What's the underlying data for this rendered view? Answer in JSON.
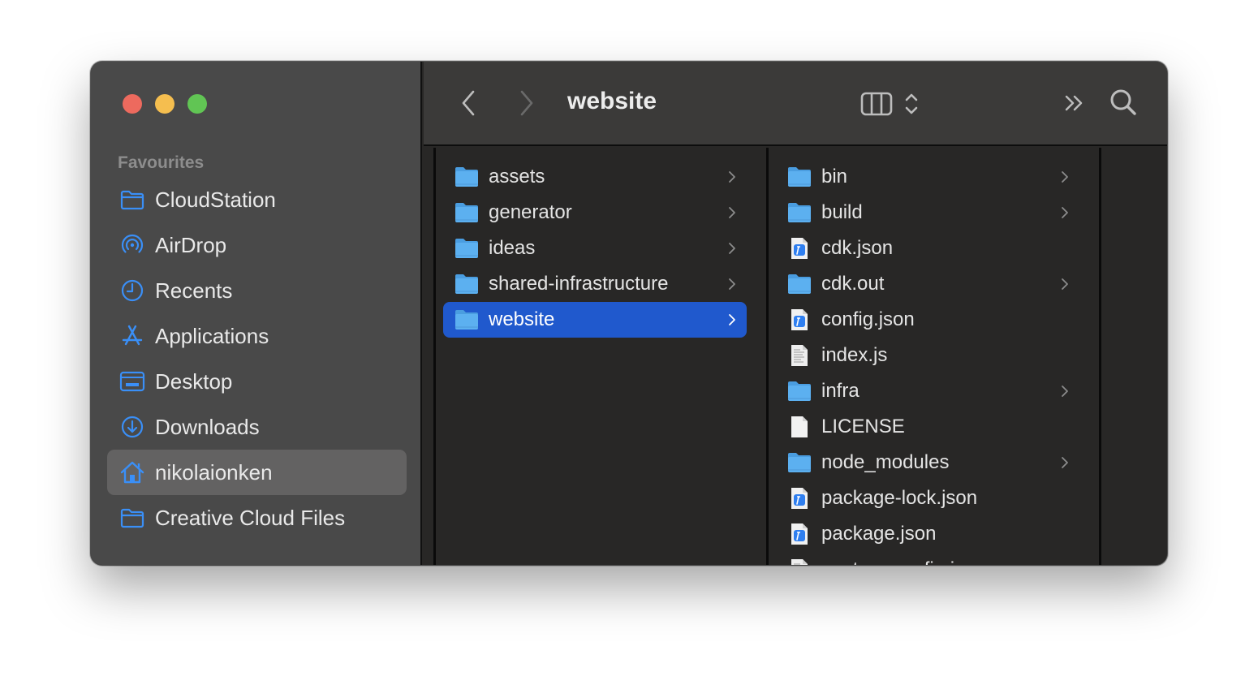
{
  "window": {
    "title": "website",
    "traffic_lights": [
      {
        "name": "close",
        "color": "#ed6a5e"
      },
      {
        "name": "minimize",
        "color": "#f5be4f"
      },
      {
        "name": "zoom",
        "color": "#61c554"
      }
    ]
  },
  "sidebar": {
    "section_label": "Favourites",
    "accent_color": "#3a8ff7",
    "items": [
      {
        "label": "CloudStation",
        "icon": "folder-icon",
        "selected": false
      },
      {
        "label": "AirDrop",
        "icon": "airdrop-icon",
        "selected": false
      },
      {
        "label": "Recents",
        "icon": "clock-icon",
        "selected": false
      },
      {
        "label": "Applications",
        "icon": "applications-icon",
        "selected": false
      },
      {
        "label": "Desktop",
        "icon": "desktop-icon",
        "selected": false
      },
      {
        "label": "Downloads",
        "icon": "download-icon",
        "selected": false
      },
      {
        "label": "nikolaionken",
        "icon": "home-icon",
        "selected": true
      },
      {
        "label": "Creative Cloud Files",
        "icon": "folder-icon",
        "selected": false
      }
    ]
  },
  "toolbar": {
    "back_icon": "chevron-left-icon",
    "forward_icon": "chevron-right-icon",
    "title": "website",
    "view_mode_icon": "column-view-icon",
    "more_icon": "double-chevron-right-icon",
    "search_icon": "search-icon"
  },
  "columns": [
    {
      "items": [
        {
          "name": "assets",
          "type": "folder",
          "has_children": true,
          "selected": false
        },
        {
          "name": "generator",
          "type": "folder",
          "has_children": true,
          "selected": false
        },
        {
          "name": "ideas",
          "type": "folder",
          "has_children": true,
          "selected": false
        },
        {
          "name": "shared-infrastructure",
          "type": "folder",
          "has_children": true,
          "selected": false
        },
        {
          "name": "website",
          "type": "folder",
          "has_children": true,
          "selected": true
        }
      ]
    },
    {
      "items": [
        {
          "name": "bin",
          "type": "folder",
          "has_children": true,
          "selected": false
        },
        {
          "name": "build",
          "type": "folder",
          "has_children": true,
          "selected": false
        },
        {
          "name": "cdk.json",
          "type": "json",
          "has_children": false,
          "selected": false
        },
        {
          "name": "cdk.out",
          "type": "folder",
          "has_children": true,
          "selected": false
        },
        {
          "name": "config.json",
          "type": "json",
          "has_children": false,
          "selected": false
        },
        {
          "name": "index.js",
          "type": "text",
          "has_children": false,
          "selected": false
        },
        {
          "name": "infra",
          "type": "folder",
          "has_children": true,
          "selected": false
        },
        {
          "name": "LICENSE",
          "type": "blank",
          "has_children": false,
          "selected": false
        },
        {
          "name": "node_modules",
          "type": "folder",
          "has_children": true,
          "selected": false
        },
        {
          "name": "package-lock.json",
          "type": "json",
          "has_children": false,
          "selected": false
        },
        {
          "name": "package.json",
          "type": "json",
          "has_children": false,
          "selected": false
        },
        {
          "name": "postcss.config.js",
          "type": "text",
          "has_children": false,
          "selected": false
        }
      ]
    },
    {
      "items": []
    }
  ],
  "colors": {
    "selection": "#2059cd",
    "sidebar_selection": "#636262",
    "folder_blue": "#5cb0f0"
  }
}
